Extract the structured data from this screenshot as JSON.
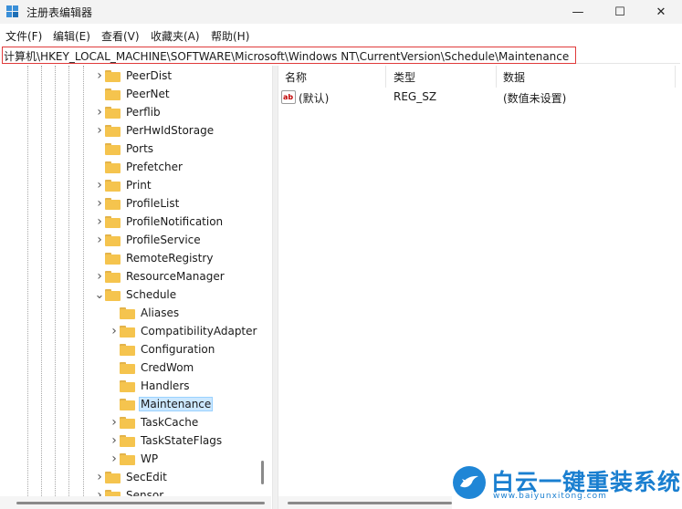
{
  "window": {
    "title": "注册表编辑器",
    "controls": {
      "minimize": "—",
      "maximize": "☐",
      "close": "✕"
    }
  },
  "menu": [
    "文件(F)",
    "编辑(E)",
    "查看(V)",
    "收藏夹(A)",
    "帮助(H)"
  ],
  "address": {
    "value": "计算机\\HKEY_LOCAL_MACHINE\\SOFTWARE\\Microsoft\\Windows NT\\CurrentVersion\\Schedule\\Maintenance",
    "highlight_color": "#e03a3a"
  },
  "tree": [
    {
      "label": "PeerDist",
      "depth": 0,
      "expander": "collapsed"
    },
    {
      "label": "PeerNet",
      "depth": 0,
      "expander": "none"
    },
    {
      "label": "Perflib",
      "depth": 0,
      "expander": "collapsed"
    },
    {
      "label": "PerHwIdStorage",
      "depth": 0,
      "expander": "collapsed"
    },
    {
      "label": "Ports",
      "depth": 0,
      "expander": "none"
    },
    {
      "label": "Prefetcher",
      "depth": 0,
      "expander": "none"
    },
    {
      "label": "Print",
      "depth": 0,
      "expander": "collapsed"
    },
    {
      "label": "ProfileList",
      "depth": 0,
      "expander": "collapsed"
    },
    {
      "label": "ProfileNotification",
      "depth": 0,
      "expander": "collapsed"
    },
    {
      "label": "ProfileService",
      "depth": 0,
      "expander": "collapsed"
    },
    {
      "label": "RemoteRegistry",
      "depth": 0,
      "expander": "none"
    },
    {
      "label": "ResourceManager",
      "depth": 0,
      "expander": "collapsed"
    },
    {
      "label": "Schedule",
      "depth": 0,
      "expander": "expanded"
    },
    {
      "label": "Aliases",
      "depth": 1,
      "expander": "none"
    },
    {
      "label": "CompatibilityAdapter",
      "depth": 1,
      "expander": "collapsed"
    },
    {
      "label": "Configuration",
      "depth": 1,
      "expander": "none"
    },
    {
      "label": "CredWom",
      "depth": 1,
      "expander": "none"
    },
    {
      "label": "Handlers",
      "depth": 1,
      "expander": "none"
    },
    {
      "label": "Maintenance",
      "depth": 1,
      "expander": "none",
      "selected": true
    },
    {
      "label": "TaskCache",
      "depth": 1,
      "expander": "collapsed"
    },
    {
      "label": "TaskStateFlags",
      "depth": 1,
      "expander": "collapsed"
    },
    {
      "label": "WP",
      "depth": 1,
      "expander": "collapsed"
    },
    {
      "label": "SecEdit",
      "depth": 0,
      "expander": "collapsed"
    },
    {
      "label": "Sensor",
      "depth": 0,
      "expander": "collapsed"
    }
  ],
  "list": {
    "columns": [
      "名称",
      "类型",
      "数据"
    ],
    "rows": [
      {
        "name": "(默认)",
        "type": "REG_SZ",
        "data": "(数值未设置)",
        "icon": "ab-string-icon"
      }
    ]
  },
  "watermark": {
    "text": "白云一键重装系统",
    "url": "www.baiyunxitong.com",
    "color": "#1a7fd0"
  }
}
